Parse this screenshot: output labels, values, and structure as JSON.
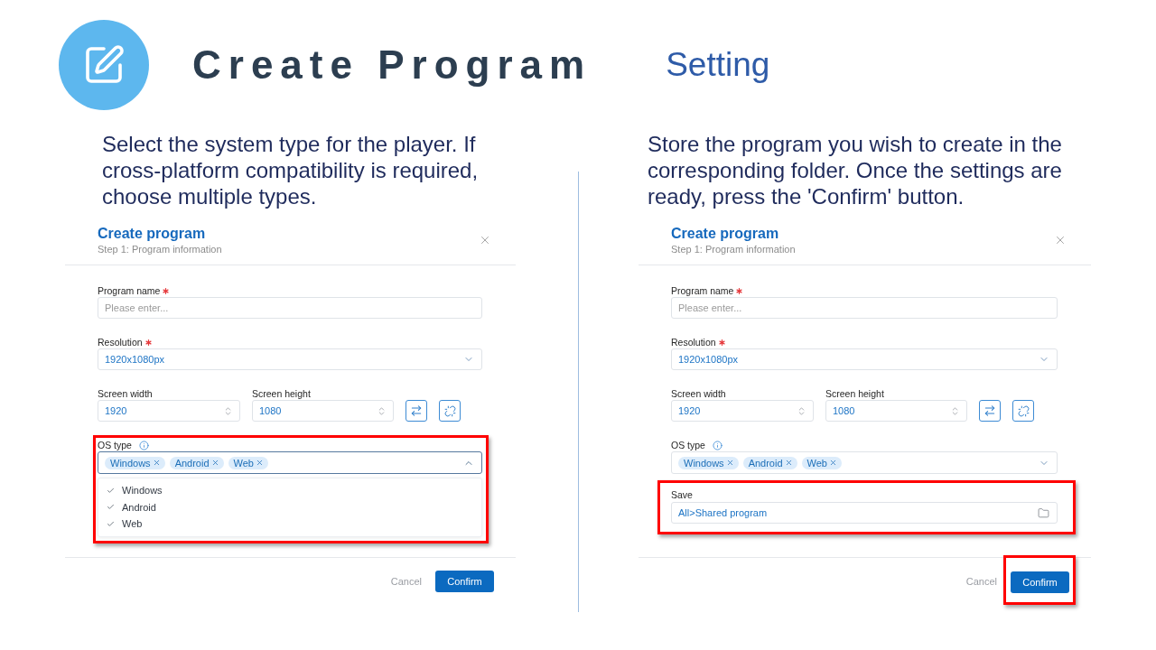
{
  "header": {
    "title": "Create Program",
    "section": "Setting"
  },
  "panels": [
    {
      "description": "Select the system type for the player. If cross-platform compatibility is required, choose multiple types.",
      "dialog": {
        "title": "Create program",
        "step": "Step 1: Program information",
        "program_name": {
          "label": "Program name",
          "required": true,
          "placeholder": "Please enter..."
        },
        "resolution": {
          "label": "Resolution",
          "required": true,
          "value": "1920x1080px"
        },
        "screen_width": {
          "label": "Screen width",
          "value": "1920"
        },
        "screen_height": {
          "label": "Screen height",
          "value": "1080"
        },
        "os_type": {
          "label": "OS type",
          "tags": [
            "Windows",
            "Android",
            "Web"
          ],
          "expanded": true,
          "highlighted": true,
          "options": [
            {
              "label": "Windows",
              "checked": true
            },
            {
              "label": "Android",
              "checked": true
            },
            {
              "label": "Web",
              "checked": true
            }
          ]
        },
        "buttons": [
          {
            "kind": "text",
            "label": "Cancel",
            "highlighted": false
          },
          {
            "kind": "primary",
            "label": "Confirm",
            "highlighted": false
          }
        ]
      }
    },
    {
      "description": "Store the program you wish to create in the corresponding folder. Once the settings are ready, press the 'Confirm' button.",
      "dialog": {
        "title": "Create program",
        "step": "Step 1: Program information",
        "program_name": {
          "label": "Program name",
          "required": true,
          "placeholder": "Please enter..."
        },
        "resolution": {
          "label": "Resolution",
          "required": true,
          "value": "1920x1080px"
        },
        "screen_width": {
          "label": "Screen width",
          "value": "1920"
        },
        "screen_height": {
          "label": "Screen height",
          "value": "1080"
        },
        "os_type": {
          "label": "OS type",
          "tags": [
            "Windows",
            "Android",
            "Web"
          ],
          "expanded": false,
          "highlighted": false
        },
        "save": {
          "label": "Save",
          "value": "All>Shared program",
          "highlighted": true
        },
        "buttons": [
          {
            "kind": "text",
            "label": "Cancel",
            "highlighted": false
          },
          {
            "kind": "primary",
            "label": "Confirm",
            "highlighted": true
          }
        ]
      }
    }
  ]
}
